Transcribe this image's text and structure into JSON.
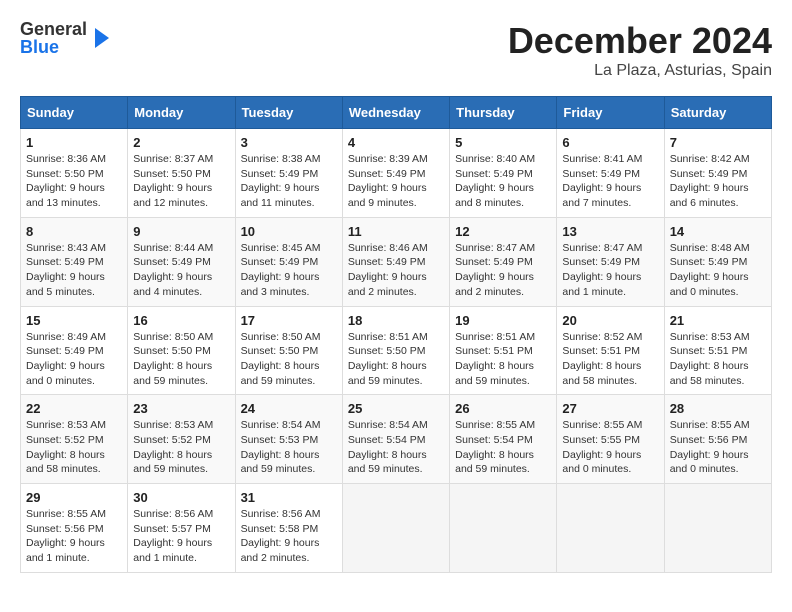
{
  "header": {
    "logo_general": "General",
    "logo_blue": "Blue",
    "title": "December 2024",
    "subtitle": "La Plaza, Asturias, Spain"
  },
  "calendar": {
    "weekdays": [
      "Sunday",
      "Monday",
      "Tuesday",
      "Wednesday",
      "Thursday",
      "Friday",
      "Saturday"
    ],
    "weeks": [
      [
        {
          "day": "1",
          "sunrise": "8:36 AM",
          "sunset": "5:50 PM",
          "daylight": "9 hours and 13 minutes."
        },
        {
          "day": "2",
          "sunrise": "8:37 AM",
          "sunset": "5:50 PM",
          "daylight": "9 hours and 12 minutes."
        },
        {
          "day": "3",
          "sunrise": "8:38 AM",
          "sunset": "5:49 PM",
          "daylight": "9 hours and 11 minutes."
        },
        {
          "day": "4",
          "sunrise": "8:39 AM",
          "sunset": "5:49 PM",
          "daylight": "9 hours and 9 minutes."
        },
        {
          "day": "5",
          "sunrise": "8:40 AM",
          "sunset": "5:49 PM",
          "daylight": "9 hours and 8 minutes."
        },
        {
          "day": "6",
          "sunrise": "8:41 AM",
          "sunset": "5:49 PM",
          "daylight": "9 hours and 7 minutes."
        },
        {
          "day": "7",
          "sunrise": "8:42 AM",
          "sunset": "5:49 PM",
          "daylight": "9 hours and 6 minutes."
        }
      ],
      [
        {
          "day": "8",
          "sunrise": "8:43 AM",
          "sunset": "5:49 PM",
          "daylight": "9 hours and 5 minutes."
        },
        {
          "day": "9",
          "sunrise": "8:44 AM",
          "sunset": "5:49 PM",
          "daylight": "9 hours and 4 minutes."
        },
        {
          "day": "10",
          "sunrise": "8:45 AM",
          "sunset": "5:49 PM",
          "daylight": "9 hours and 3 minutes."
        },
        {
          "day": "11",
          "sunrise": "8:46 AM",
          "sunset": "5:49 PM",
          "daylight": "9 hours and 2 minutes."
        },
        {
          "day": "12",
          "sunrise": "8:47 AM",
          "sunset": "5:49 PM",
          "daylight": "9 hours and 2 minutes."
        },
        {
          "day": "13",
          "sunrise": "8:47 AM",
          "sunset": "5:49 PM",
          "daylight": "9 hours and 1 minute."
        },
        {
          "day": "14",
          "sunrise": "8:48 AM",
          "sunset": "5:49 PM",
          "daylight": "9 hours and 0 minutes."
        }
      ],
      [
        {
          "day": "15",
          "sunrise": "8:49 AM",
          "sunset": "5:49 PM",
          "daylight": "9 hours and 0 minutes."
        },
        {
          "day": "16",
          "sunrise": "8:50 AM",
          "sunset": "5:50 PM",
          "daylight": "8 hours and 59 minutes."
        },
        {
          "day": "17",
          "sunrise": "8:50 AM",
          "sunset": "5:50 PM",
          "daylight": "8 hours and 59 minutes."
        },
        {
          "day": "18",
          "sunrise": "8:51 AM",
          "sunset": "5:50 PM",
          "daylight": "8 hours and 59 minutes."
        },
        {
          "day": "19",
          "sunrise": "8:51 AM",
          "sunset": "5:51 PM",
          "daylight": "8 hours and 59 minutes."
        },
        {
          "day": "20",
          "sunrise": "8:52 AM",
          "sunset": "5:51 PM",
          "daylight": "8 hours and 58 minutes."
        },
        {
          "day": "21",
          "sunrise": "8:53 AM",
          "sunset": "5:51 PM",
          "daylight": "8 hours and 58 minutes."
        }
      ],
      [
        {
          "day": "22",
          "sunrise": "8:53 AM",
          "sunset": "5:52 PM",
          "daylight": "8 hours and 58 minutes."
        },
        {
          "day": "23",
          "sunrise": "8:53 AM",
          "sunset": "5:52 PM",
          "daylight": "8 hours and 59 minutes."
        },
        {
          "day": "24",
          "sunrise": "8:54 AM",
          "sunset": "5:53 PM",
          "daylight": "8 hours and 59 minutes."
        },
        {
          "day": "25",
          "sunrise": "8:54 AM",
          "sunset": "5:54 PM",
          "daylight": "8 hours and 59 minutes."
        },
        {
          "day": "26",
          "sunrise": "8:55 AM",
          "sunset": "5:54 PM",
          "daylight": "8 hours and 59 minutes."
        },
        {
          "day": "27",
          "sunrise": "8:55 AM",
          "sunset": "5:55 PM",
          "daylight": "9 hours and 0 minutes."
        },
        {
          "day": "28",
          "sunrise": "8:55 AM",
          "sunset": "5:56 PM",
          "daylight": "9 hours and 0 minutes."
        }
      ],
      [
        {
          "day": "29",
          "sunrise": "8:55 AM",
          "sunset": "5:56 PM",
          "daylight": "9 hours and 1 minute."
        },
        {
          "day": "30",
          "sunrise": "8:56 AM",
          "sunset": "5:57 PM",
          "daylight": "9 hours and 1 minute."
        },
        {
          "day": "31",
          "sunrise": "8:56 AM",
          "sunset": "5:58 PM",
          "daylight": "9 hours and 2 minutes."
        },
        null,
        null,
        null,
        null
      ]
    ]
  }
}
